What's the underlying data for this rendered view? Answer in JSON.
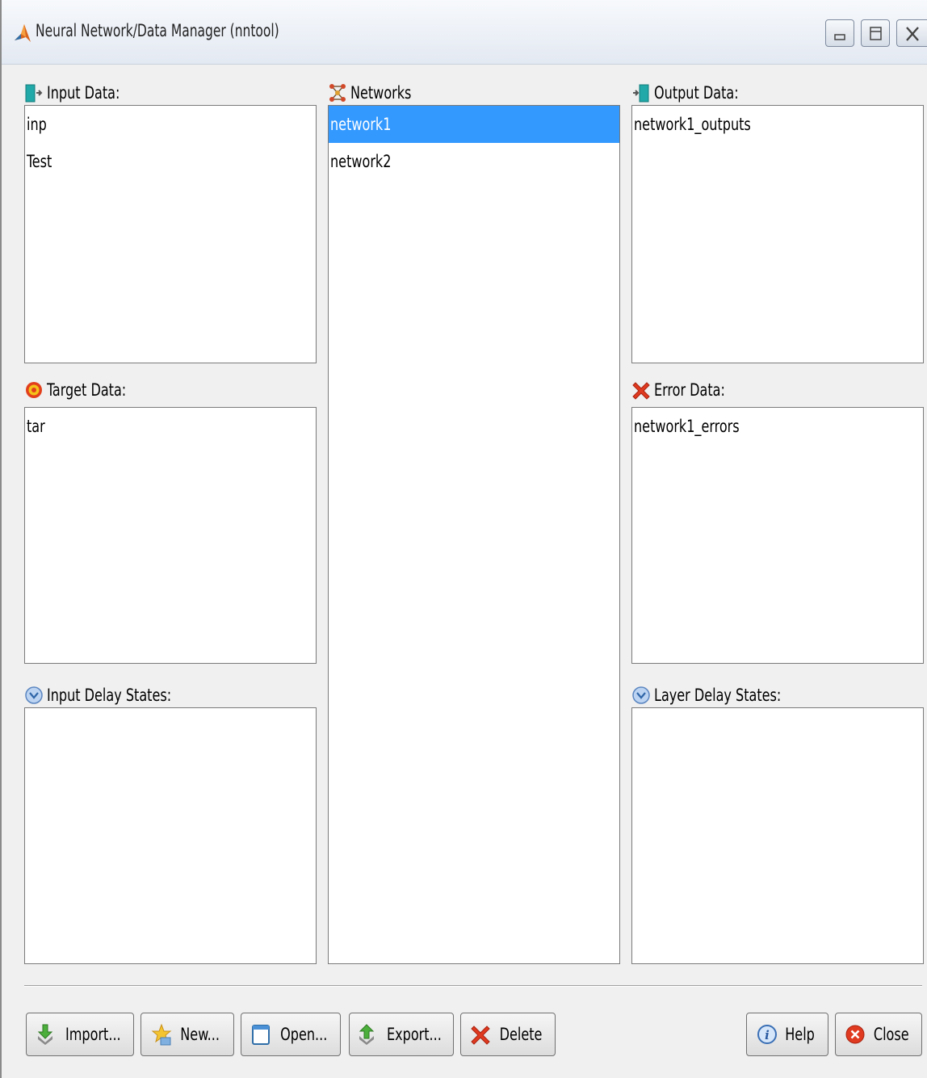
{
  "window": {
    "title": "Neural Network/Data Manager (nntool)"
  },
  "panels": {
    "input_data": {
      "label": "Input Data:",
      "items": [
        "inp",
        "Test"
      ]
    },
    "target_data": {
      "label": "Target Data:",
      "items": [
        "tar"
      ]
    },
    "input_delay_states": {
      "label": "Input Delay States:",
      "items": []
    },
    "networks": {
      "label": "Networks",
      "items": [
        "network1",
        "network2"
      ],
      "selected": "network1"
    },
    "output_data": {
      "label": "Output Data:",
      "items": [
        "network1_outputs"
      ]
    },
    "error_data": {
      "label": "Error Data:",
      "items": [
        "network1_errors"
      ]
    },
    "layer_delay_states": {
      "label": "Layer Delay States:",
      "items": []
    }
  },
  "buttons": {
    "import": "Import...",
    "new": "New...",
    "open": "Open...",
    "export": "Export...",
    "delete": "Delete",
    "help": "Help",
    "close": "Close"
  },
  "colors": {
    "selection": "#3399ff",
    "list_background": "#ffffff",
    "window_background": "#f0f0f0"
  }
}
